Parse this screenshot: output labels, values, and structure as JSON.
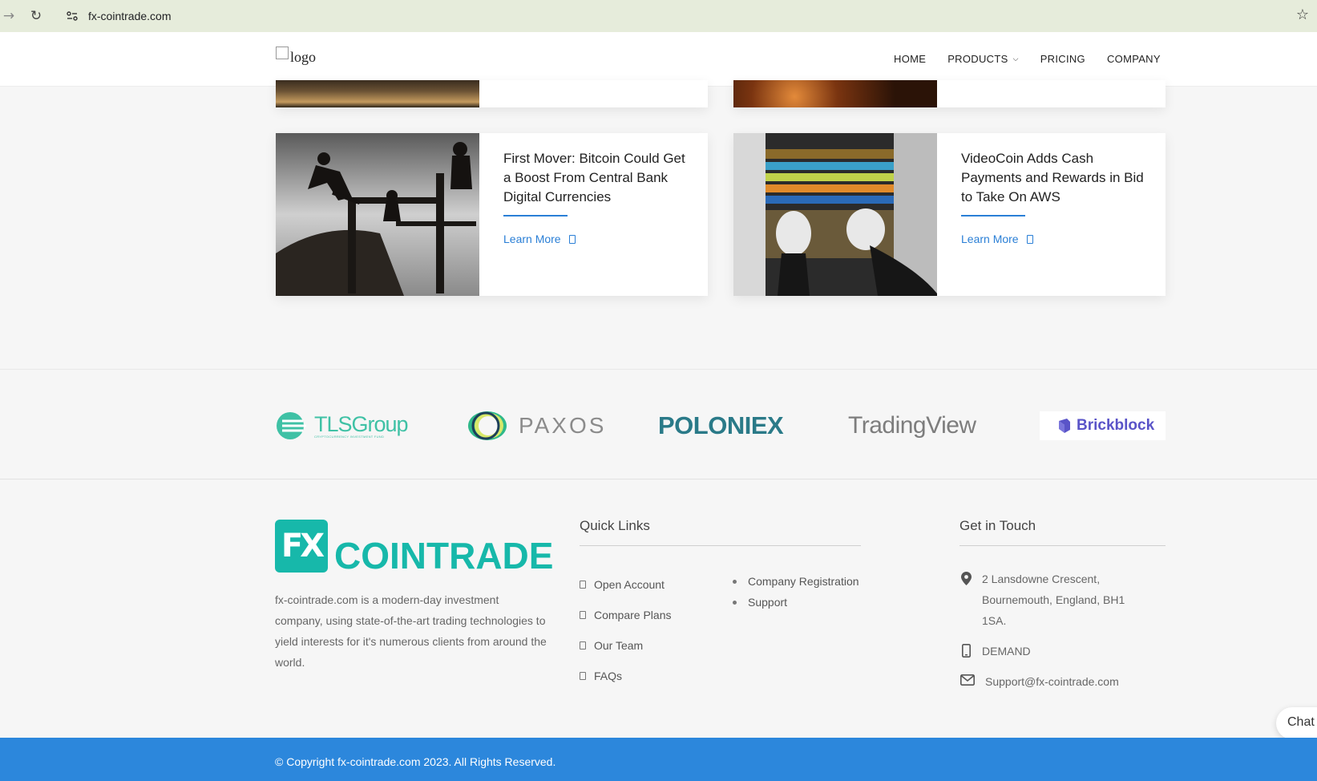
{
  "browser": {
    "url": "fx-cointrade.com"
  },
  "header": {
    "logo_alt": "logo",
    "nav": [
      {
        "label": "HOME"
      },
      {
        "label": "PRODUCTS"
      },
      {
        "label": "PRICING"
      },
      {
        "label": "COMPANY"
      }
    ]
  },
  "cards": [
    {
      "title": "First Mover: Bitcoin Could Get a Boost From Central Bank Digital Currencies",
      "link": "Learn More"
    },
    {
      "title": "VideoCoin Adds Cash Payments and Rewards in Bid to Take On AWS",
      "link": "Learn More"
    }
  ],
  "partners": [
    {
      "name": "TLSGroup",
      "tagline": "CRYPTOCURRENCY INVESTMENT FUND"
    },
    {
      "name": "PAXOS"
    },
    {
      "name": "POLONIEX"
    },
    {
      "name": "TradingView"
    },
    {
      "name": "Brickblock"
    }
  ],
  "footer": {
    "brand_mark": "FX",
    "brand_word": "COINTRADE",
    "about": "fx-cointrade.com is a modern-day investment company, using state-of-the-art trading technologies to yield interests for it's numerous clients from around the world.",
    "quick_links_title": "Quick Links",
    "quick_links": [
      "Open Account",
      "Compare Plans",
      "Our Team",
      "FAQs"
    ],
    "quick_links_2": [
      "Company Registration",
      "Support"
    ],
    "contact_title": "Get in Touch",
    "address": "2 Lansdowne Crescent, Bournemouth, England, BH1 1SA.",
    "phone": "DEMAND",
    "email": "Support@fx-cointrade.com",
    "chat": "Chat",
    "copyright": "© Copyright fx-cointrade.com 2023. All Rights Reserved."
  },
  "colors": {
    "accent": "#2a7fd6",
    "brand_teal": "#17b8aa",
    "footer_bar": "#2c87dc"
  }
}
